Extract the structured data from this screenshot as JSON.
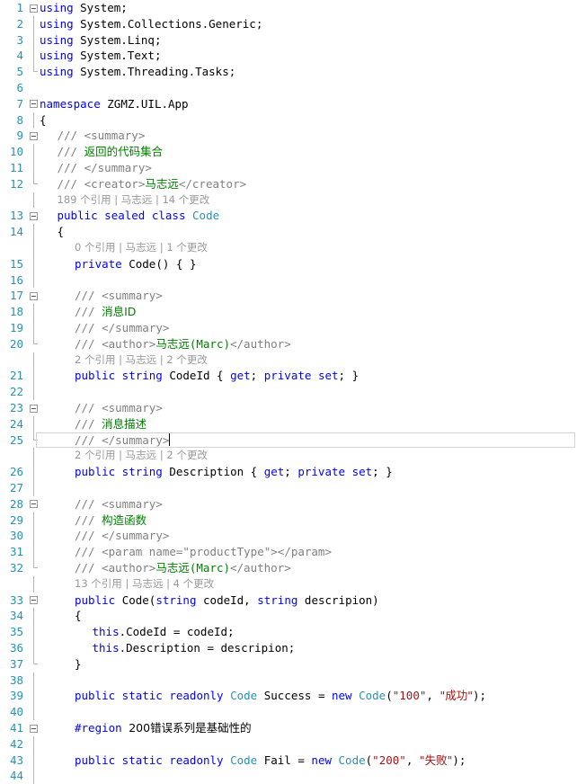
{
  "editor": {
    "language": "csharp",
    "cursor_line": 25,
    "colors": {
      "keyword": "#0000FF",
      "type": "#2B91AF",
      "string": "#A31515",
      "comment": "#008000",
      "xml_tag": "#808080",
      "line_number": "#2B91AF",
      "codelens": "#999999",
      "background": "#FFFFFF",
      "current_line_border": "#D3D3D3"
    }
  },
  "lines": [
    {
      "n": "1",
      "fold": "open",
      "segs": [
        {
          "t": "using ",
          "c": "kw"
        },
        {
          "t": "System;",
          "c": "plain"
        }
      ]
    },
    {
      "n": "2",
      "guide": "line",
      "segs": [
        {
          "t": "using ",
          "c": "kw"
        },
        {
          "t": "System.Collections.Generic;",
          "c": "plain"
        }
      ]
    },
    {
      "n": "3",
      "guide": "line",
      "segs": [
        {
          "t": "using ",
          "c": "kw"
        },
        {
          "t": "System.Linq;",
          "c": "plain"
        }
      ]
    },
    {
      "n": "4",
      "guide": "line",
      "segs": [
        {
          "t": "using ",
          "c": "kw"
        },
        {
          "t": "System.Text;",
          "c": "plain"
        }
      ]
    },
    {
      "n": "5",
      "guide": "end",
      "segs": [
        {
          "t": "using ",
          "c": "kw"
        },
        {
          "t": "System.Threading.Tasks;",
          "c": "plain"
        }
      ]
    },
    {
      "n": "6",
      "segs": []
    },
    {
      "n": "7",
      "fold": "open",
      "segs": [
        {
          "t": "namespace ",
          "c": "kw"
        },
        {
          "t": "ZGMZ.UIL.App",
          "c": "plain"
        }
      ]
    },
    {
      "n": "8",
      "guide": "line",
      "segs": [
        {
          "t": "{",
          "c": "plain"
        }
      ]
    },
    {
      "n": "9",
      "fold": "open",
      "indent": 1,
      "segs": [
        {
          "t": "/// ",
          "c": "xml"
        },
        {
          "t": "<summary>",
          "c": "xml"
        }
      ]
    },
    {
      "n": "10",
      "guide": "line",
      "indent": 1,
      "segs": [
        {
          "t": "/// ",
          "c": "xml"
        },
        {
          "t": "返回的代码集合",
          "c": "cmt"
        }
      ]
    },
    {
      "n": "11",
      "guide": "line",
      "indent": 1,
      "segs": [
        {
          "t": "/// ",
          "c": "xml"
        },
        {
          "t": "</summary>",
          "c": "xml"
        }
      ]
    },
    {
      "n": "12",
      "guide": "end",
      "indent": 1,
      "segs": [
        {
          "t": "/// ",
          "c": "xml"
        },
        {
          "t": "<creator>",
          "c": "xml"
        },
        {
          "t": "马志远",
          "c": "cmt"
        },
        {
          "t": "</creator>",
          "c": "xml"
        }
      ]
    },
    {
      "lens": "189 个引用 | 马志远 | 14 个更改",
      "indent": 1
    },
    {
      "n": "13",
      "fold": "open",
      "indent": 1,
      "segs": [
        {
          "t": "public sealed class ",
          "c": "kw"
        },
        {
          "t": "Code",
          "c": "type"
        }
      ]
    },
    {
      "n": "14",
      "guide": "line",
      "indent": 1,
      "segs": [
        {
          "t": "{",
          "c": "plain"
        }
      ]
    },
    {
      "lens": "0 个引用 | 马志远 | 1 个更改",
      "indent": 2
    },
    {
      "n": "15",
      "guide": "line",
      "indent": 2,
      "segs": [
        {
          "t": "private ",
          "c": "kw"
        },
        {
          "t": "Code() { }",
          "c": "plain"
        }
      ]
    },
    {
      "n": "16",
      "guide": "line",
      "segs": []
    },
    {
      "n": "17",
      "fold": "open",
      "indent": 2,
      "segs": [
        {
          "t": "/// ",
          "c": "xml"
        },
        {
          "t": "<summary>",
          "c": "xml"
        }
      ]
    },
    {
      "n": "18",
      "guide": "line",
      "indent": 2,
      "segs": [
        {
          "t": "/// ",
          "c": "xml"
        },
        {
          "t": "消息ID",
          "c": "cmt"
        }
      ]
    },
    {
      "n": "19",
      "guide": "line",
      "indent": 2,
      "segs": [
        {
          "t": "/// ",
          "c": "xml"
        },
        {
          "t": "</summary>",
          "c": "xml"
        }
      ]
    },
    {
      "n": "20",
      "guide": "end",
      "indent": 2,
      "segs": [
        {
          "t": "/// ",
          "c": "xml"
        },
        {
          "t": "<author>",
          "c": "xml"
        },
        {
          "t": "马志远",
          "c": "cmt"
        },
        {
          "t": "(Marc)",
          "c": "cmt"
        },
        {
          "t": "</author>",
          "c": "xml"
        }
      ]
    },
    {
      "lens": "2 个引用 | 马志远 | 2 个更改",
      "indent": 2
    },
    {
      "n": "21",
      "guide": "line",
      "indent": 2,
      "segs": [
        {
          "t": "public string ",
          "c": "kw"
        },
        {
          "t": "CodeId { ",
          "c": "plain"
        },
        {
          "t": "get",
          "c": "kw"
        },
        {
          "t": "; ",
          "c": "plain"
        },
        {
          "t": "private set",
          "c": "kw"
        },
        {
          "t": "; }",
          "c": "plain"
        }
      ]
    },
    {
      "n": "22",
      "guide": "line",
      "segs": []
    },
    {
      "n": "23",
      "fold": "open",
      "indent": 2,
      "segs": [
        {
          "t": "/// ",
          "c": "xml"
        },
        {
          "t": "<summary>",
          "c": "xml"
        }
      ]
    },
    {
      "n": "24",
      "guide": "line",
      "indent": 2,
      "segs": [
        {
          "t": "/// ",
          "c": "xml"
        },
        {
          "t": "消息描述",
          "c": "cmt"
        }
      ]
    },
    {
      "n": "25",
      "guide": "end",
      "current": true,
      "indent": 2,
      "segs": [
        {
          "t": "/// ",
          "c": "xml"
        },
        {
          "t": "</summary>",
          "c": "xml"
        }
      ]
    },
    {
      "lens": "2 个引用 | 马志远 | 2 个更改",
      "indent": 2
    },
    {
      "n": "26",
      "guide": "line",
      "indent": 2,
      "segs": [
        {
          "t": "public string ",
          "c": "kw"
        },
        {
          "t": "Description { ",
          "c": "plain"
        },
        {
          "t": "get",
          "c": "kw"
        },
        {
          "t": "; ",
          "c": "plain"
        },
        {
          "t": "private set",
          "c": "kw"
        },
        {
          "t": "; }",
          "c": "plain"
        }
      ]
    },
    {
      "n": "27",
      "guide": "line",
      "segs": []
    },
    {
      "n": "28",
      "fold": "open",
      "indent": 2,
      "segs": [
        {
          "t": "/// ",
          "c": "xml"
        },
        {
          "t": "<summary>",
          "c": "xml"
        }
      ]
    },
    {
      "n": "29",
      "guide": "line",
      "indent": 2,
      "segs": [
        {
          "t": "/// ",
          "c": "xml"
        },
        {
          "t": "构造函数",
          "c": "cmt"
        }
      ]
    },
    {
      "n": "30",
      "guide": "line",
      "indent": 2,
      "segs": [
        {
          "t": "/// ",
          "c": "xml"
        },
        {
          "t": "</summary>",
          "c": "xml"
        }
      ]
    },
    {
      "n": "31",
      "guide": "line",
      "indent": 2,
      "segs": [
        {
          "t": "/// ",
          "c": "xml"
        },
        {
          "t": "<param name=\"productType\"></param>",
          "c": "xml"
        }
      ]
    },
    {
      "n": "32",
      "guide": "end",
      "indent": 2,
      "segs": [
        {
          "t": "/// ",
          "c": "xml"
        },
        {
          "t": "<author>",
          "c": "xml"
        },
        {
          "t": "马志远",
          "c": "cmt"
        },
        {
          "t": "(Marc)",
          "c": "cmt"
        },
        {
          "t": "</author>",
          "c": "xml"
        }
      ]
    },
    {
      "lens": "13 个引用 | 马志远 | 4 个更改",
      "indent": 2
    },
    {
      "n": "33",
      "fold": "open",
      "indent": 2,
      "segs": [
        {
          "t": "public ",
          "c": "kw"
        },
        {
          "t": "Code(",
          "c": "plain"
        },
        {
          "t": "string ",
          "c": "kw"
        },
        {
          "t": "codeId, ",
          "c": "plain"
        },
        {
          "t": "string ",
          "c": "kw"
        },
        {
          "t": "descripion)",
          "c": "plain"
        }
      ]
    },
    {
      "n": "34",
      "guide": "line",
      "indent": 2,
      "segs": [
        {
          "t": "{",
          "c": "plain"
        }
      ]
    },
    {
      "n": "35",
      "guide": "line",
      "indent": 3,
      "segs": [
        {
          "t": "this",
          "c": "kw"
        },
        {
          "t": ".CodeId = codeId;",
          "c": "plain"
        }
      ]
    },
    {
      "n": "36",
      "guide": "line",
      "indent": 3,
      "segs": [
        {
          "t": "this",
          "c": "kw"
        },
        {
          "t": ".Description = descripion;",
          "c": "plain"
        }
      ]
    },
    {
      "n": "37",
      "guide": "end",
      "indent": 2,
      "segs": [
        {
          "t": "}",
          "c": "plain"
        }
      ]
    },
    {
      "n": "38",
      "guide": "line",
      "segs": []
    },
    {
      "n": "39",
      "guide": "line",
      "indent": 2,
      "segs": [
        {
          "t": "public static readonly ",
          "c": "kw"
        },
        {
          "t": "Code ",
          "c": "type"
        },
        {
          "t": "Success = ",
          "c": "plain"
        },
        {
          "t": "new ",
          "c": "kw"
        },
        {
          "t": "Code",
          "c": "type"
        },
        {
          "t": "(",
          "c": "plain"
        },
        {
          "t": "\"100\"",
          "c": "str"
        },
        {
          "t": ", ",
          "c": "plain"
        },
        {
          "t": "\"成功\"",
          "c": "str"
        },
        {
          "t": ");",
          "c": "plain"
        }
      ]
    },
    {
      "n": "40",
      "guide": "line",
      "segs": []
    },
    {
      "n": "41",
      "fold": "open",
      "indent": 2,
      "segs": [
        {
          "t": "#region ",
          "c": "pp"
        },
        {
          "t": "200错误系列是基础性的",
          "c": "plain"
        }
      ]
    },
    {
      "n": "42",
      "guide": "line",
      "segs": []
    },
    {
      "n": "43",
      "guide": "line",
      "indent": 2,
      "segs": [
        {
          "t": "public static readonly ",
          "c": "kw"
        },
        {
          "t": "Code ",
          "c": "type"
        },
        {
          "t": "Fail = ",
          "c": "plain"
        },
        {
          "t": "new ",
          "c": "kw"
        },
        {
          "t": "Code",
          "c": "type"
        },
        {
          "t": "(",
          "c": "plain"
        },
        {
          "t": "\"200\"",
          "c": "str"
        },
        {
          "t": ", ",
          "c": "plain"
        },
        {
          "t": "\"失败\"",
          "c": "str"
        },
        {
          "t": ");",
          "c": "plain"
        }
      ]
    },
    {
      "n": "44",
      "guide": "line",
      "segs": []
    }
  ]
}
